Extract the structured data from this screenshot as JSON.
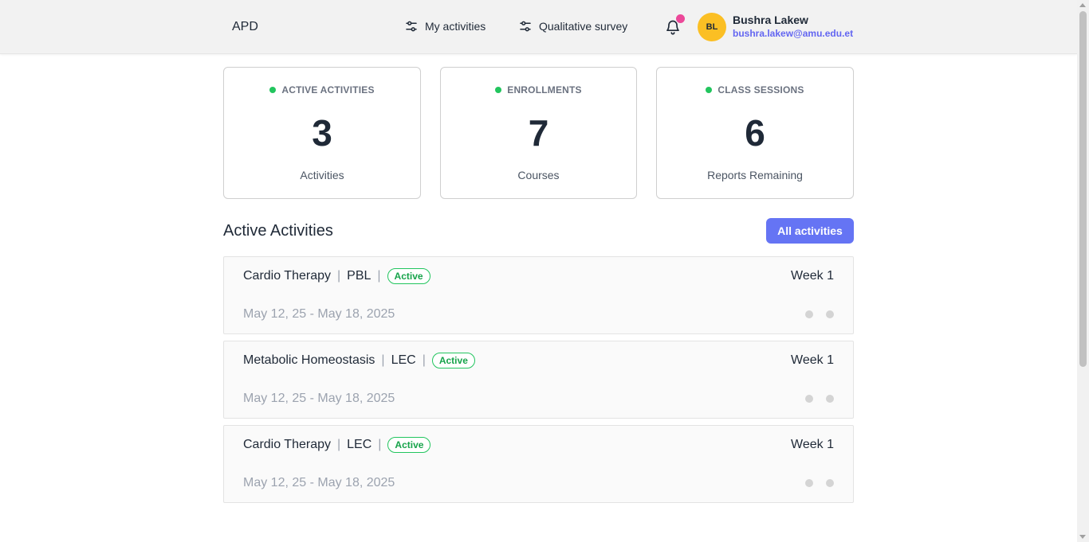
{
  "header": {
    "brand": "APD",
    "nav": [
      {
        "label": "My activities",
        "icon": "sliders-icon"
      },
      {
        "label": "Qualitative survey",
        "icon": "sliders-icon"
      }
    ],
    "notifications_icon": "bell-icon",
    "user": {
      "initials": "BL",
      "name": "Bushra Lakew",
      "email": "bushra.lakew@amu.edu.et"
    }
  },
  "stats": [
    {
      "heading": "ACTIVE ACTIVITIES",
      "value": "3",
      "sub": "Activities"
    },
    {
      "heading": "ENROLLMENTS",
      "value": "7",
      "sub": "Courses"
    },
    {
      "heading": "CLASS SESSIONS",
      "value": "6",
      "sub": "Reports Remaining"
    }
  ],
  "section": {
    "title": "Active Activities",
    "button_label": "All activities"
  },
  "activities": [
    {
      "name": "Cardio Therapy",
      "type": "PBL",
      "status": "Active",
      "week": "Week 1",
      "dates": "May 12, 25 - May 18, 2025"
    },
    {
      "name": "Metabolic Homeostasis",
      "type": "LEC",
      "status": "Active",
      "week": "Week 1",
      "dates": "May 12, 25 - May 18, 2025"
    },
    {
      "name": "Cardio Therapy",
      "type": "LEC",
      "status": "Active",
      "week": "Week 1",
      "dates": "May 12, 25 - May 18, 2025"
    }
  ],
  "colors": {
    "accent": "#6574f4",
    "status_green": "#22c55e",
    "notification_dot": "#ec4899",
    "avatar_bg": "#fbbf24"
  }
}
